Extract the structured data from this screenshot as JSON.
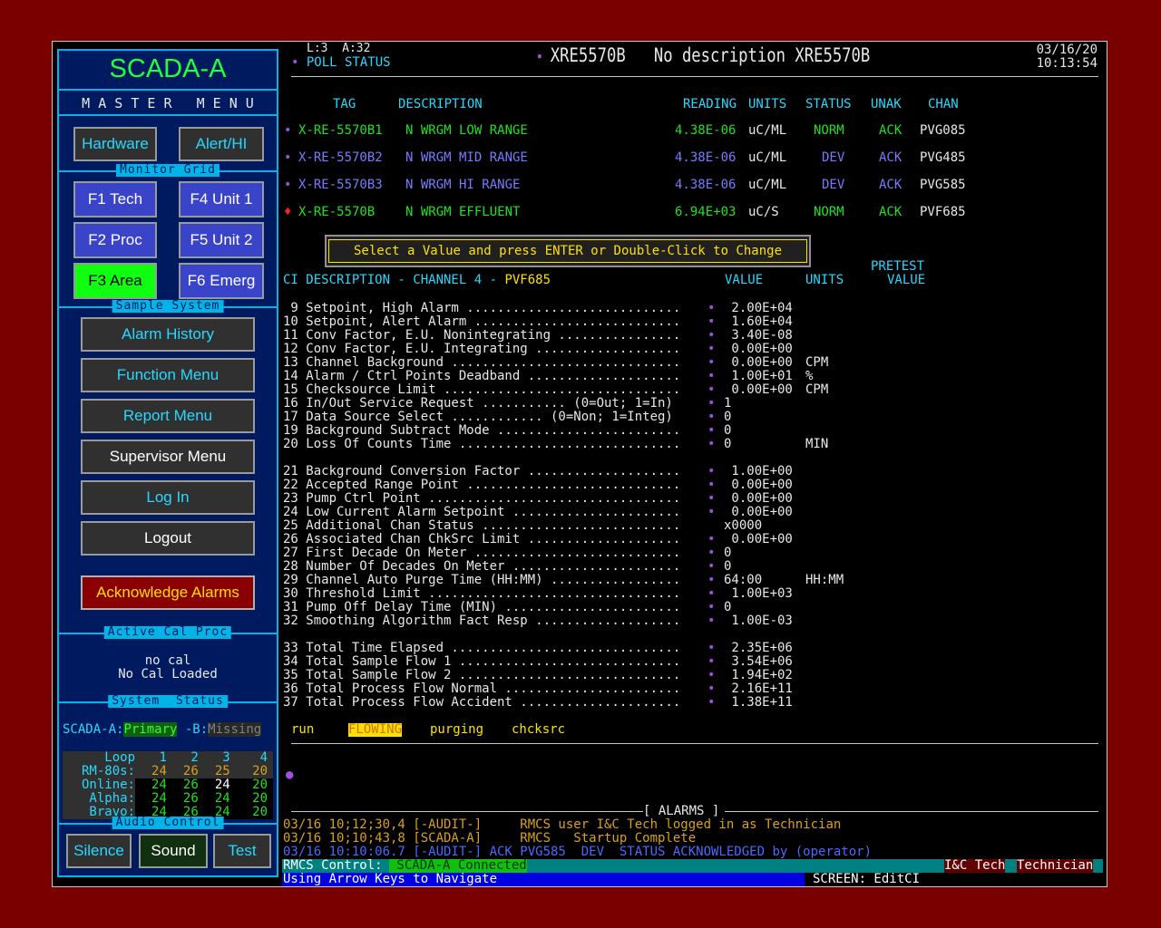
{
  "left": {
    "title": "SCADA-A",
    "master_menu": "M A S T E R   M E N U",
    "hardware": "Hardware",
    "alert_hi": "Alert/HI",
    "monitor_grid_title": "Monitor Grid",
    "f1": "F1 Tech",
    "f4": "F4 Unit 1",
    "f2": "F2 Proc",
    "f5": "F5 Unit 2",
    "f3": "F3 Area",
    "f6": "F6 Emerg",
    "sample_system_title": "Sample System",
    "alarm_history": "Alarm History",
    "function_menu": "Function Menu",
    "report_menu": "Report Menu",
    "supervisor_menu": "Supervisor Menu",
    "log_in": "Log In",
    "logout": "Logout",
    "acknowledge_alarms": "Acknowledge Alarms",
    "active_cal_title": "Active Cal Proc",
    "no_cal": "no cal",
    "no_cal_loaded": "No Cal Loaded",
    "system_status_title": "System  Status",
    "scada_a_label": "SCADA-A:",
    "scada_a_value": "Primary",
    "scada_b_label": " -B:",
    "scada_b_value": "Missing",
    "loop_table": {
      "header": [
        "Loop",
        "1",
        "2",
        "3",
        "4"
      ],
      "rows": [
        {
          "label": "RM-80s:",
          "values": [
            "24",
            "26",
            "25",
            "20"
          ]
        },
        {
          "label": "Online:",
          "values": [
            "24",
            "26",
            "24",
            "20"
          ]
        },
        {
          "label": "Alpha:",
          "values": [
            "24",
            "26",
            "24",
            "20"
          ]
        },
        {
          "label": "Bravo:",
          "values": [
            "24",
            "26",
            "24",
            "20"
          ]
        }
      ]
    },
    "audio_control_title": "Audio Control",
    "silence": "Silence",
    "sound": "Sound",
    "test": "Test"
  },
  "header": {
    "lines": "L:3  A:32",
    "poll_status": "POLL STATUS",
    "tag_title": "XRE5570B   No description XRE5570B",
    "date": "03/16/20",
    "time": "10:13:54"
  },
  "tag_table": {
    "columns": [
      "TAG",
      "DESCRIPTION",
      "READING",
      "UNITS",
      "STATUS",
      "UNAK",
      "CHAN"
    ],
    "rows": [
      {
        "tag": "X-RE-5570B1",
        "desc": "N WRGM LOW RANGE",
        "reading": "4.38E-06",
        "units": "uC/ML",
        "status": "NORM",
        "unak": "ACK",
        "chan": "PVG085"
      },
      {
        "tag": "X-RE-5570B2",
        "desc": "N WRGM MID RANGE",
        "reading": "4.38E-06",
        "units": "uC/ML",
        "status": "DEV",
        "unak": "ACK",
        "chan": "PVG485"
      },
      {
        "tag": "X-RE-5570B3",
        "desc": "N WRGM HI RANGE",
        "reading": "4.38E-06",
        "units": "uC/ML",
        "status": "DEV",
        "unak": "ACK",
        "chan": "PVG585"
      },
      {
        "tag": "X-RE-5570B",
        "desc": "N WRGM EFFLUENT",
        "reading": "6.94E+03",
        "units": "uC/S",
        "status": "NORM",
        "unak": "ACK",
        "chan": "PVF685"
      }
    ]
  },
  "prompt": "Select a Value and press ENTER or Double-Click to Change",
  "ci_header": {
    "ci_desc": "CI DESCRIPTION - CHANNEL 4 - ",
    "channel": "PVF685",
    "value": "VALUE",
    "units": "UNITS",
    "pretest_1": "PRETEST",
    "pretest_2": "VALUE"
  },
  "ci_rows": [
    {
      "line": " 9 Setpoint, High Alarm ............................",
      "dot": true,
      "value": " 2.00E+04",
      "units": ""
    },
    {
      "line": "10 Setpoint, Alert Alarm ...........................",
      "dot": true,
      "value": " 1.60E+04",
      "units": ""
    },
    {
      "line": "11 Conv Factor, E.U. Nonintegrating ................",
      "dot": true,
      "value": " 3.40E-08",
      "units": ""
    },
    {
      "line": "12 Conv Factor, E.U. Integrating ...................",
      "dot": true,
      "value": " 0.00E+00",
      "units": ""
    },
    {
      "line": "13 Channel Background ..............................",
      "dot": true,
      "value": " 0.00E+00",
      "units": "CPM"
    },
    {
      "line": "14 Alarm / Ctrl Points Deadband ....................",
      "dot": true,
      "value": " 1.00E+01",
      "units": "%"
    },
    {
      "line": "15 Checksource Limit ...............................",
      "dot": true,
      "value": " 0.00E+00",
      "units": "CPM"
    },
    {
      "line": "16 In/Out Service Request ........... (0=Out; 1=In)",
      "dot": true,
      "value": "1",
      "units": ""
    },
    {
      "line": "17 Data Source Select ............ (0=Non; 1=Integ)",
      "dot": true,
      "value": "0",
      "units": ""
    },
    {
      "line": "19 Background Subtract Mode ........................",
      "dot": true,
      "value": "0",
      "units": ""
    },
    {
      "line": "20 Loss Of Counts Time .............................",
      "dot": true,
      "value": "0",
      "units": "MIN"
    },
    {
      "line": "",
      "dot": false,
      "value": "",
      "units": ""
    },
    {
      "line": "21 Background Conversion Factor ....................",
      "dot": true,
      "value": " 1.00E+00",
      "units": ""
    },
    {
      "line": "22 Accepted Range Point ............................",
      "dot": true,
      "value": " 0.00E+00",
      "units": ""
    },
    {
      "line": "23 Pump Ctrl Point .................................",
      "dot": true,
      "value": " 0.00E+00",
      "units": ""
    },
    {
      "line": "24 Low Current Alarm Setpoint ......................",
      "dot": true,
      "value": " 0.00E+00",
      "units": ""
    },
    {
      "line": "25 Additional Chan Status ..........................",
      "dot": false,
      "value": "x0000",
      "units": ""
    },
    {
      "line": "26 Associated Chan ChkSrc Limit ....................",
      "dot": true,
      "value": " 0.00E+00",
      "units": ""
    },
    {
      "line": "27 First Decade On Meter ...........................",
      "dot": true,
      "value": "0",
      "units": ""
    },
    {
      "line": "28 Number Of Decades On Meter ......................",
      "dot": true,
      "value": "0",
      "units": ""
    },
    {
      "line": "29 Channel Auto Purge Time (HH:MM) .................",
      "dot": true,
      "value": "64:00",
      "units": "HH:MM"
    },
    {
      "line": "30 Threshold Limit .................................",
      "dot": true,
      "value": " 1.00E+03",
      "units": ""
    },
    {
      "line": "31 Pump Off Delay Time (MIN) .......................",
      "dot": true,
      "value": "0",
      "units": ""
    },
    {
      "line": "32 Smoothing Algorithm Fact Resp ...................",
      "dot": true,
      "value": " 1.00E-03",
      "units": ""
    },
    {
      "line": "",
      "dot": false,
      "value": "",
      "units": ""
    },
    {
      "line": "33 Total Time Elapsed ..............................",
      "dot": true,
      "value": " 2.35E+06",
      "units": ""
    },
    {
      "line": "34 Total Sample Flow 1 .............................",
      "dot": true,
      "value": " 3.54E+06",
      "units": ""
    },
    {
      "line": "35 Total Sample Flow 2 .............................",
      "dot": true,
      "value": " 1.94E+02",
      "units": ""
    },
    {
      "line": "36 Total Process Flow Normal .......................",
      "dot": true,
      "value": " 2.16E+11",
      "units": ""
    },
    {
      "line": "37 Total Process Flow Accident .....................",
      "dot": true,
      "value": " 1.38E+11",
      "units": ""
    }
  ],
  "state_flags": {
    "run": "run",
    "flowing": "FLOWING",
    "purging": "purging",
    "chcksrc": "chcksrc"
  },
  "alarms": {
    "title": "[ ALARMS ]",
    "lines": [
      "03/16 10;12;30,4 [-AUDIT-]     RMCS user I&C Tech logged in as Technician",
      "03/16 10;10;43,8 [SCADA-A]     RMCS   Startup Complete",
      "03/16 10:10:06.7 [-AUDIT-] ACK PVG585  DEV  STATUS ACKNOWLEDGED by (operator)"
    ]
  },
  "status_bar": {
    "rmcs_label": "RMCS Control:",
    "rmcs_value": " SCADA-A Connected",
    "user": "I&C Tech",
    "role": "Technician",
    "nav_hint": "Using Arrow Keys to Navigate",
    "screen": "SCREEN: EditCI"
  },
  "colors": {
    "background": "#7a0000",
    "panel": "#001a60",
    "accent": "#00b4e8",
    "green": "#20e020",
    "blue_text": "#7a7aff",
    "yellow": "#ffe000"
  }
}
